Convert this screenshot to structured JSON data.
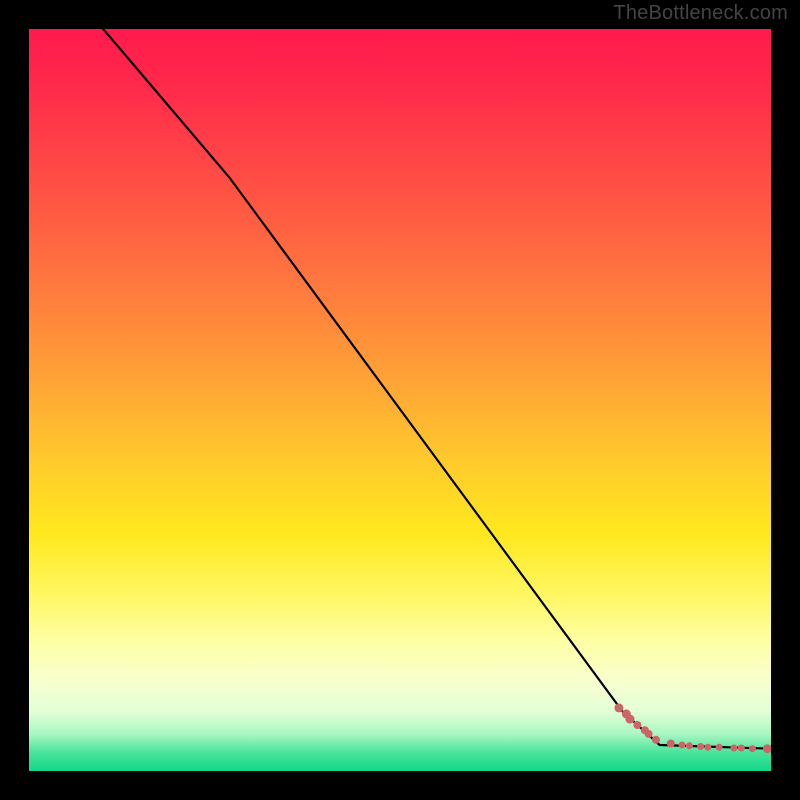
{
  "watermark": "TheBottleneck.com",
  "colors": {
    "frame": "#000000",
    "line": "#000000",
    "dot_fill": "#cc6666",
    "dot_stroke": "#cc6666",
    "gradient_stops": [
      "#ff1a4d",
      "#ff2a4a",
      "#ff5244",
      "#ff7a3e",
      "#ffa236",
      "#ffc92c",
      "#ffe81e",
      "#fff86a",
      "#fdffa8",
      "#f8ffcf",
      "#e2ffd6",
      "#a9f7c3",
      "#4ae39a",
      "#13d789"
    ]
  },
  "chart_data": {
    "type": "line",
    "title": "",
    "xlabel": "",
    "ylabel": "",
    "xlim": [
      0,
      100
    ],
    "ylim": [
      0,
      100
    ],
    "y_inverted": true,
    "series": [
      {
        "name": "curve",
        "style": "line",
        "x": [
          10,
          27,
          80,
          85,
          100
        ],
        "y": [
          0,
          20,
          92,
          96.5,
          97
        ]
      },
      {
        "name": "dots",
        "style": "scatter",
        "comment": "cluster of rose dots along the flattened tail",
        "x": [
          79.5,
          80.5,
          81.0,
          82.0,
          83.0,
          83.5,
          84.5,
          86.5,
          88.0,
          89.0,
          90.5,
          91.5,
          93.0,
          95.0,
          96.0,
          97.5,
          99.5
        ],
        "y": [
          91.5,
          92.3,
          93.0,
          93.8,
          94.5,
          95.0,
          95.8,
          96.3,
          96.5,
          96.6,
          96.7,
          96.8,
          96.8,
          96.9,
          96.9,
          97.0,
          97.0
        ],
        "r": [
          4.5,
          4.5,
          4.5,
          4.0,
          4.0,
          4.0,
          4.0,
          4.0,
          3.5,
          3.5,
          3.5,
          3.5,
          3.5,
          3.5,
          3.5,
          3.5,
          4.5
        ]
      }
    ]
  }
}
